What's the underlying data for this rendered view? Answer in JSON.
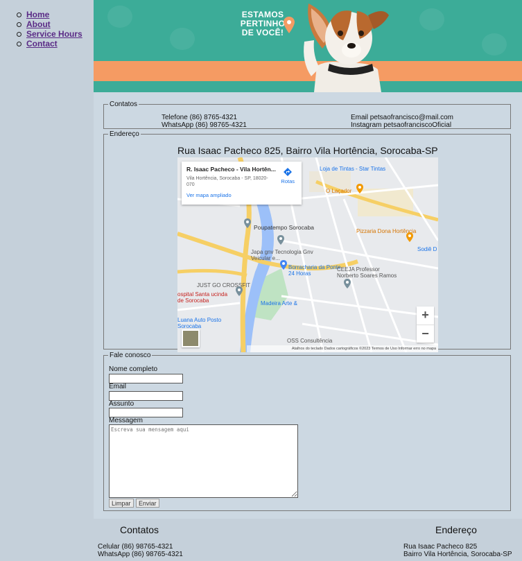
{
  "nav": {
    "items": [
      "Home",
      "About",
      "Service Hours",
      "Contact"
    ]
  },
  "banner": {
    "slogan": [
      "ESTAMOS",
      "PERTINHO",
      "DE VOCÊ!"
    ]
  },
  "contatos": {
    "legend": "Contatos",
    "telefone": "Telefone (86) 8765-4321",
    "whatsapp": "WhatsApp (86) 98765-4321",
    "email": "Email petsaofrancisco@mail.com",
    "instagram": "Instagram petsaofranciscoOficial"
  },
  "endereco": {
    "legend": "Endereço",
    "title": "Rua Isaac Pacheco 825, Bairro Vila Hortência, Sorocaba-SP",
    "map": {
      "card_title": "R. Isaac Pacheco - Vila Hortên...",
      "card_address": "Vila Hortência, Sorocaba - SP, 18020-070",
      "card_link": "Ver mapa ampliado",
      "directions_label": "Rotas",
      "zoom_in": "+",
      "zoom_out": "−",
      "places": [
        "Loja de Tintas - Star Tintas",
        "O Laçador",
        "Poupatempo Sorocaba",
        "Pizzaria Dona Hortência",
        "Japa gnv Tecnologia Gnv Veicular e...",
        "Borracharia da Ponte 24 Horas",
        "CEEJA Professor Norberto Soares Ramos",
        "JUST GO CROSSFIT",
        "ospital Santa ucinda de Sorocaba",
        "Madeira Arte &",
        "Luana Auto Posto Sorocaba",
        "OSS Consultência",
        "Sodiê D"
      ],
      "attribution": "Atalhos do teclado   Dados cartográficos ©2023   Termos de Uso   Informar erro no mapa"
    }
  },
  "fale": {
    "legend": "Fale conosco",
    "nome_label": "Nome completo",
    "email_label": "Email",
    "assunto_label": "Assunto",
    "mensagem_label": "Messagem",
    "mensagem_placeholder": "Escreva sua mensagem aqui",
    "limpar": "Limpar",
    "enviar": "Enviar"
  },
  "footer": {
    "contatos_title": "Contatos",
    "celular": "Celular (86) 98765-4321",
    "whatsapp": "WhatsApp (86) 98765-4321",
    "endereco_title": "Endereço",
    "rua": "Rua Isaac Pacheco 825",
    "bairro": "Bairro Vila Hortência, Sorocaba-SP"
  },
  "colors": {
    "banner_teal": "#3cac98",
    "banner_orange": "#f59b63",
    "page_bg": "#c5d0da",
    "link_purple": "#5a2a86"
  }
}
